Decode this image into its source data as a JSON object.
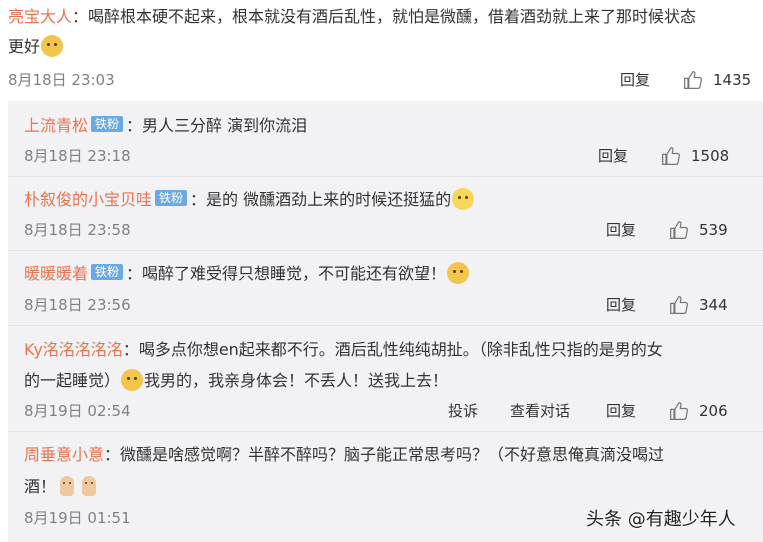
{
  "main": {
    "user": "亮宝大人",
    "line1": "：喝醉根本硬不起来，根本就没有酒后乱性，就怕是微醺，借着酒劲就上来了那时候状态",
    "line2": "更好",
    "time": "8月18日 23:03",
    "reply_label": "回复",
    "likes": "1435"
  },
  "replies": [
    {
      "user": "上流青松",
      "badge": "铁粉",
      "text": "：男人三分醉 演到你流泪",
      "time": "8月18日 23:18",
      "reply_label": "回复",
      "likes": "1508"
    },
    {
      "user": "朴叙俊的小宝贝哇",
      "badge": "铁粉",
      "text": "：是的 微醺酒劲上来的时候还挺猛的",
      "time": "8月18日 23:58",
      "reply_label": "回复",
      "likes": "539"
    },
    {
      "user": "暖暖暖着",
      "badge": "铁粉",
      "text": "：喝醉了难受得只想睡觉，不可能还有欲望！",
      "time": "8月18日 23:56",
      "reply_label": "回复",
      "likes": "344"
    },
    {
      "user": "Ky洺洺洺洺洺",
      "text": "：喝多点你想en起来都不行。酒后乱性纯纯胡扯。（除非乱性只指的是男的女",
      "text2a": "的一起睡觉）",
      "text2b": "我男的，我亲身体会！不丢人！送我上去！",
      "time": "8月19日 02:54",
      "report_label": "投诉",
      "view_label": "查看对话",
      "reply_label": "回复",
      "likes": "206"
    },
    {
      "user": "周垂意小意",
      "text": "：微醺是啥感觉啊？半醉不醉吗？脑子能正常思考吗？（不好意思俺真滴没喝过",
      "text2": "酒！",
      "time": "8月19日 01:51"
    }
  ],
  "watermark": "头条 @有趣少年人",
  "icons": [
    "thumbs-up-icon",
    "doge-emoji-icon",
    "laugh-emoji-icon",
    "baby-emoji-icon"
  ],
  "colors": {
    "username": "#eb7350",
    "badge": "#6aa9e6",
    "reply_bg": "#f2f2f5",
    "meta": "#808080"
  }
}
